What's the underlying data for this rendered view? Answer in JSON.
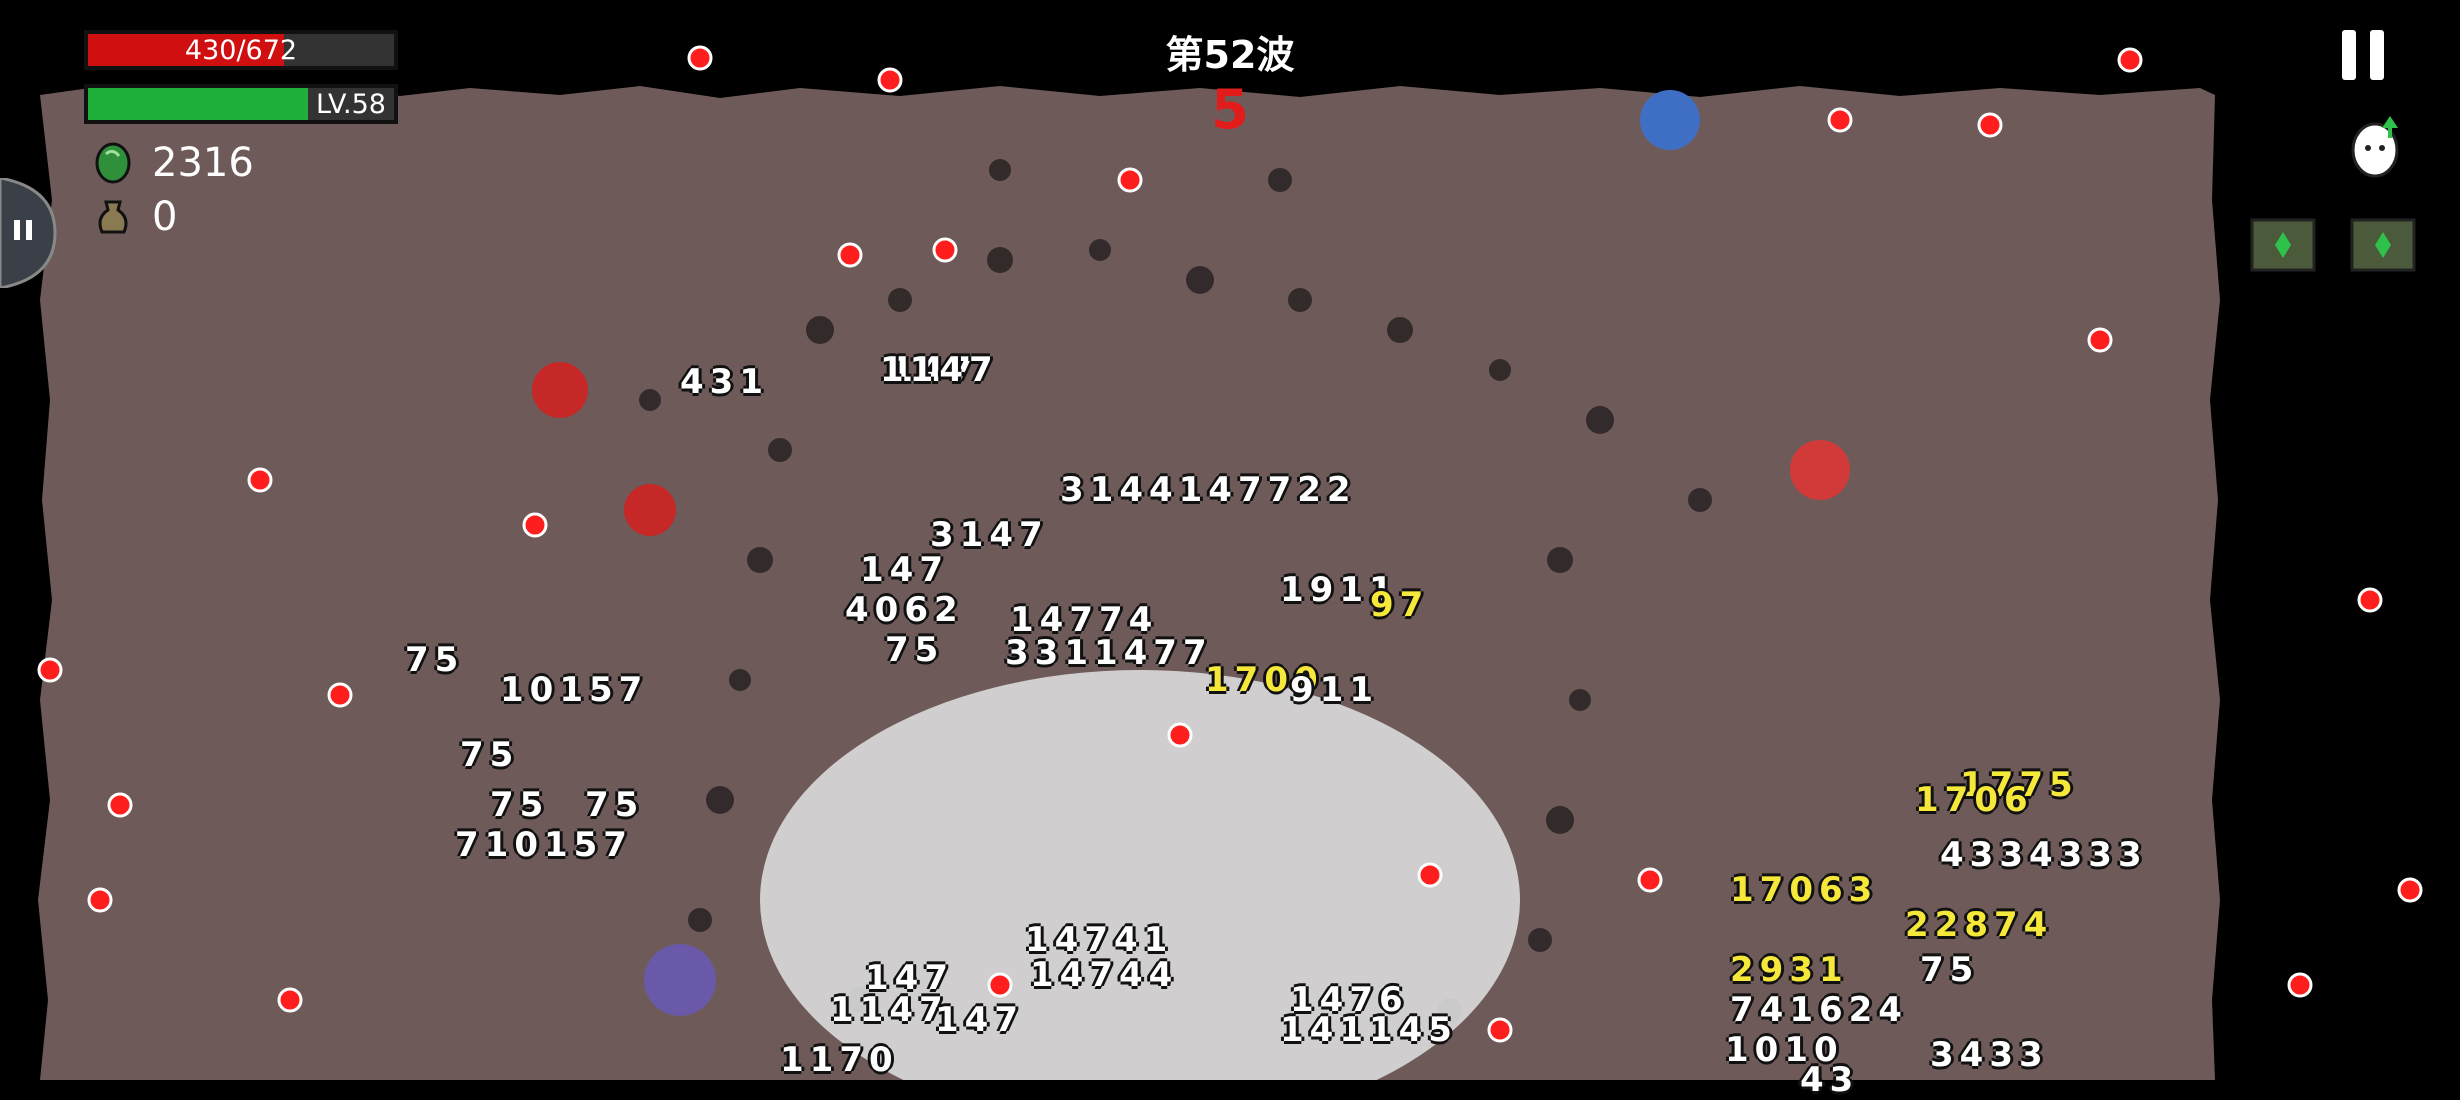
{
  "hud": {
    "hp_text": "430/672",
    "hp_fraction": 0.64,
    "level_text": "LV.58",
    "xp_fraction": 0.72,
    "coins": "2316",
    "bags": "0",
    "wave_title": "第52波",
    "wave_countdown": "5"
  },
  "damage_numbers": [
    "431",
    "147",
    "1147",
    "3144147722",
    "3147",
    "147",
    "4062",
    "75",
    "14774",
    "3311477",
    "1911",
    "97",
    "1700",
    "911",
    "75",
    "10157",
    "75",
    "75",
    "75",
    "710157",
    "14741",
    "147",
    "1147",
    "14744",
    "147",
    "1170",
    "1476",
    "141145",
    "17063",
    "1775",
    "4334333",
    "1706",
    "22874",
    "2931",
    "741624",
    "3433",
    "1010",
    "43",
    "75"
  ],
  "icons": {
    "coin": "green-gem-icon",
    "bag": "money-bag-icon",
    "pause": "pause-icon",
    "egg": "egg-mascot-icon",
    "crate": "supply-crate-icon",
    "edge": "side-tab-icon"
  },
  "colors": {
    "hp": "#d01010",
    "xp": "#1fb03a",
    "ground": "#6e5b59",
    "projectile": "#ff1e1e",
    "countdown": "#e21b1b"
  }
}
